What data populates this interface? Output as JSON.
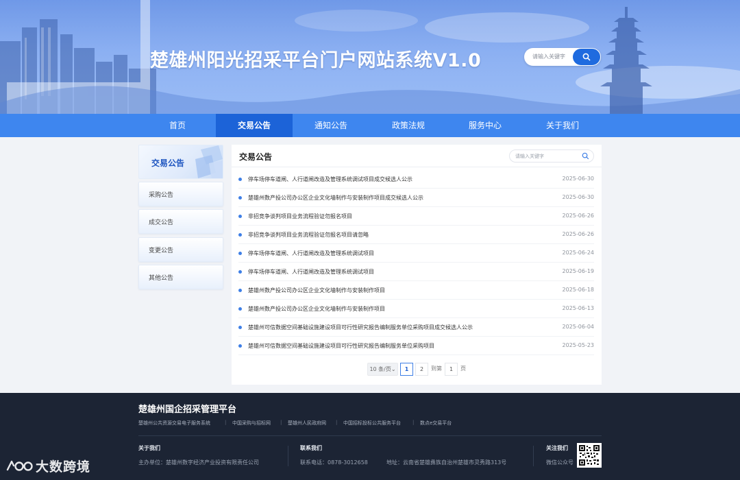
{
  "banner": {
    "title": "楚雄州阳光招采平台门户网站系统V1.0",
    "search_placeholder": "请输入关键字"
  },
  "nav": {
    "items": [
      {
        "label": "首页",
        "active": false
      },
      {
        "label": "交易公告",
        "active": true
      },
      {
        "label": "通知公告",
        "active": false
      },
      {
        "label": "政策法规",
        "active": false
      },
      {
        "label": "服务中心",
        "active": false
      },
      {
        "label": "关于我们",
        "active": false
      }
    ]
  },
  "sidebar": {
    "heading": "交易公告",
    "items": [
      {
        "label": "采购公告"
      },
      {
        "label": "成交公告"
      },
      {
        "label": "变更公告"
      },
      {
        "label": "其他公告"
      }
    ]
  },
  "main": {
    "title": "交易公告",
    "search_placeholder": "请输入关键字",
    "notices": [
      {
        "title": "停车场停车道闸、人行道闸改造及管理系统调试项目成交候选人公示",
        "date": "2025-06-30"
      },
      {
        "title": "楚雄州数产投公司办公区企业文化墙制作与安装制作项目成交候选人公示",
        "date": "2025-06-30"
      },
      {
        "title": "非招竞争谈判项目业务流程验证勿报名项目",
        "date": "2025-06-26"
      },
      {
        "title": "非招竞争谈判项目业务流程验证勿报名项目请忽略",
        "date": "2025-06-26"
      },
      {
        "title": "停车场停车道闸、人行道闸改造及管理系统调试项目",
        "date": "2025-06-24"
      },
      {
        "title": "停车场停车道闸、人行道闸改造及管理系统调试项目",
        "date": "2025-06-19"
      },
      {
        "title": "楚雄州数产投公司办公区企业文化墙制作与安装制作项目",
        "date": "2025-06-18"
      },
      {
        "title": "楚雄州数产投公司办公区企业文化墙制作与安装制作项目",
        "date": "2025-06-13"
      },
      {
        "title": "楚雄州可信数据空间基础设施建设项目可行性研究报告编制服务单位采购项目成交候选人公示",
        "date": "2025-06-04"
      },
      {
        "title": "楚雄州可信数据空间基础设施建设项目可行性研究报告编制服务单位采购项目",
        "date": "2025-05-23"
      }
    ],
    "pagination": {
      "page_size": "10 条/页",
      "pages": [
        "1",
        "2"
      ],
      "current": "1",
      "goto_label": "到第",
      "goto_value": "1",
      "page_suffix": "页"
    }
  },
  "footer": {
    "title": "楚雄州国企招采管理平台",
    "links": [
      "楚雄州公共资源交易电子服务系统",
      "中国采购与招标网",
      "楚雄州人民政府网",
      "中国招标投标公共服务平台",
      "数点e交易平台"
    ],
    "separator": "|",
    "about": {
      "heading": "关于我们",
      "text": "主办单位：楚雄州数字经济产业投资有限责任公司"
    },
    "contact": {
      "heading": "联系我们",
      "phone": "联系电话：0878-3012658",
      "address": "地址：云南省楚雄彝族自治州楚雄市灵秀路313号"
    },
    "follow": {
      "heading": "关注我们",
      "text": "微信公众号"
    }
  },
  "watermark": {
    "text": "大数跨境"
  },
  "colors": {
    "primary": "#1f6bdf",
    "nav": "#3e86ef",
    "nav_active": "#1c63d8",
    "footer": "#1c2434"
  }
}
